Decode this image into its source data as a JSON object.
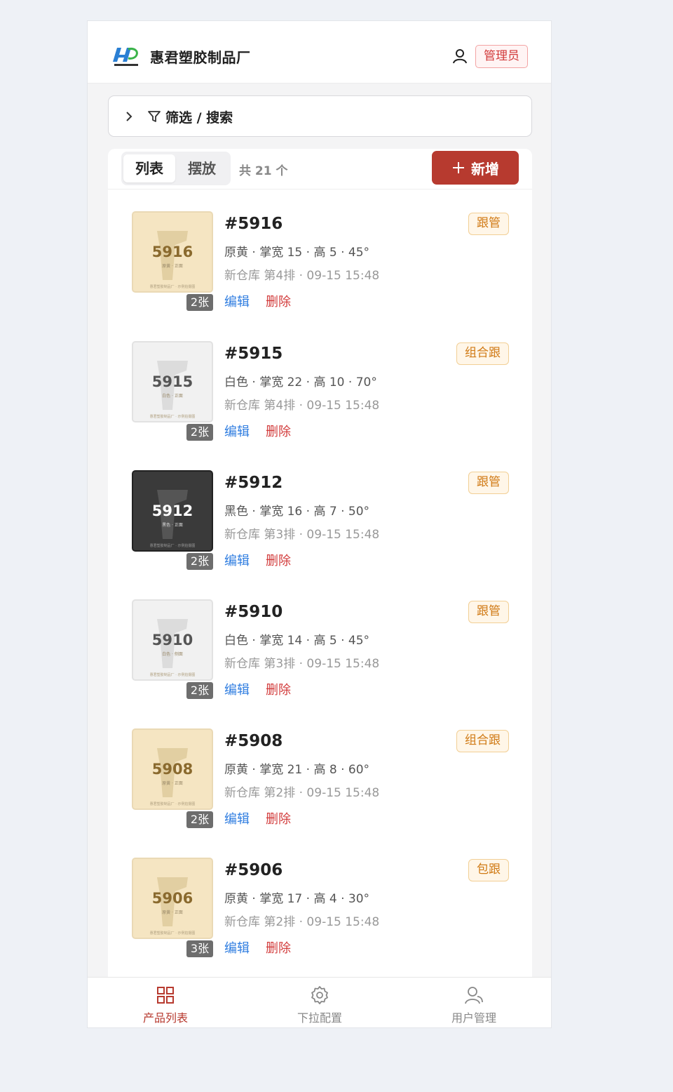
{
  "app": {
    "brand": "惠君塑胶制品厂",
    "logo_caption": "惠君塑胶制品厂",
    "role_badge": "管理员"
  },
  "filter": {
    "label": "筛选 / 搜索"
  },
  "toolbar": {
    "view_tabs": [
      {
        "label": "列表",
        "active": true
      },
      {
        "label": "摆放",
        "active": false
      }
    ],
    "count_text": "共 21 个",
    "add_label": "新增"
  },
  "items": [
    {
      "thumb_number": "5916",
      "thumb_sub": "原黄 · 正面",
      "thumb_foot": "惠君塑胶制品厂 · 示例拍摄图",
      "thumb_color": "yellow",
      "photo_count": "2张",
      "code": "#5916",
      "spec": "原黄 · 掌宽 15 · 高 5 · 45°",
      "location": "新仓库 第4排 · 09-15 15:48",
      "tag": "跟管",
      "edit": "编辑",
      "delete": "删除"
    },
    {
      "thumb_number": "5915",
      "thumb_sub": "白色 · 正面",
      "thumb_foot": "惠君塑胶制品厂 · 示例拍摄图",
      "thumb_color": "white",
      "photo_count": "2张",
      "code": "#5915",
      "spec": "白色 · 掌宽 22 · 高 10 · 70°",
      "location": "新仓库 第4排 · 09-15 15:48",
      "tag": "组合跟",
      "edit": "编辑",
      "delete": "删除"
    },
    {
      "thumb_number": "5912",
      "thumb_sub": "黑色 · 正面",
      "thumb_foot": "惠君塑胶制品厂 · 示例拍摄图",
      "thumb_color": "black",
      "photo_count": "2张",
      "code": "#5912",
      "spec": "黑色 · 掌宽 16 · 高 7 · 50°",
      "location": "新仓库 第3排 · 09-15 15:48",
      "tag": "跟管",
      "edit": "编辑",
      "delete": "删除"
    },
    {
      "thumb_number": "5910",
      "thumb_sub": "白色 · 侧面",
      "thumb_foot": "惠君塑胶制品厂 · 示例拍摄图",
      "thumb_color": "white",
      "photo_count": "2张",
      "code": "#5910",
      "spec": "白色 · 掌宽 14 · 高 5 · 45°",
      "location": "新仓库 第3排 · 09-15 15:48",
      "tag": "跟管",
      "edit": "编辑",
      "delete": "删除"
    },
    {
      "thumb_number": "5908",
      "thumb_sub": "原黄 · 正面",
      "thumb_foot": "惠君塑胶制品厂 · 示例拍摄图",
      "thumb_color": "yellow",
      "photo_count": "2张",
      "code": "#5908",
      "spec": "原黄 · 掌宽 21 · 高 8 · 60°",
      "location": "新仓库 第2排 · 09-15 15:48",
      "tag": "组合跟",
      "edit": "编辑",
      "delete": "删除"
    },
    {
      "thumb_number": "5906",
      "thumb_sub": "原黄 · 正面",
      "thumb_foot": "惠君塑胶制品厂 · 示例拍摄图",
      "thumb_color": "yellow",
      "photo_count": "3张",
      "code": "#5906",
      "spec": "原黄 · 掌宽 17 · 高 4 · 30°",
      "location": "新仓库 第2排 · 09-15 15:48",
      "tag": "包跟",
      "edit": "编辑",
      "delete": "删除"
    }
  ],
  "tabbar": [
    {
      "label": "产品列表",
      "icon": "grid-icon",
      "active": true
    },
    {
      "label": "下拉配置",
      "icon": "gear-icon",
      "active": false
    },
    {
      "label": "用户管理",
      "icon": "users-icon",
      "active": false
    }
  ],
  "colors": {
    "accent": "#b73a2f",
    "link": "#2f7de0",
    "danger": "#d23b3b",
    "tag": "#d07a15"
  }
}
